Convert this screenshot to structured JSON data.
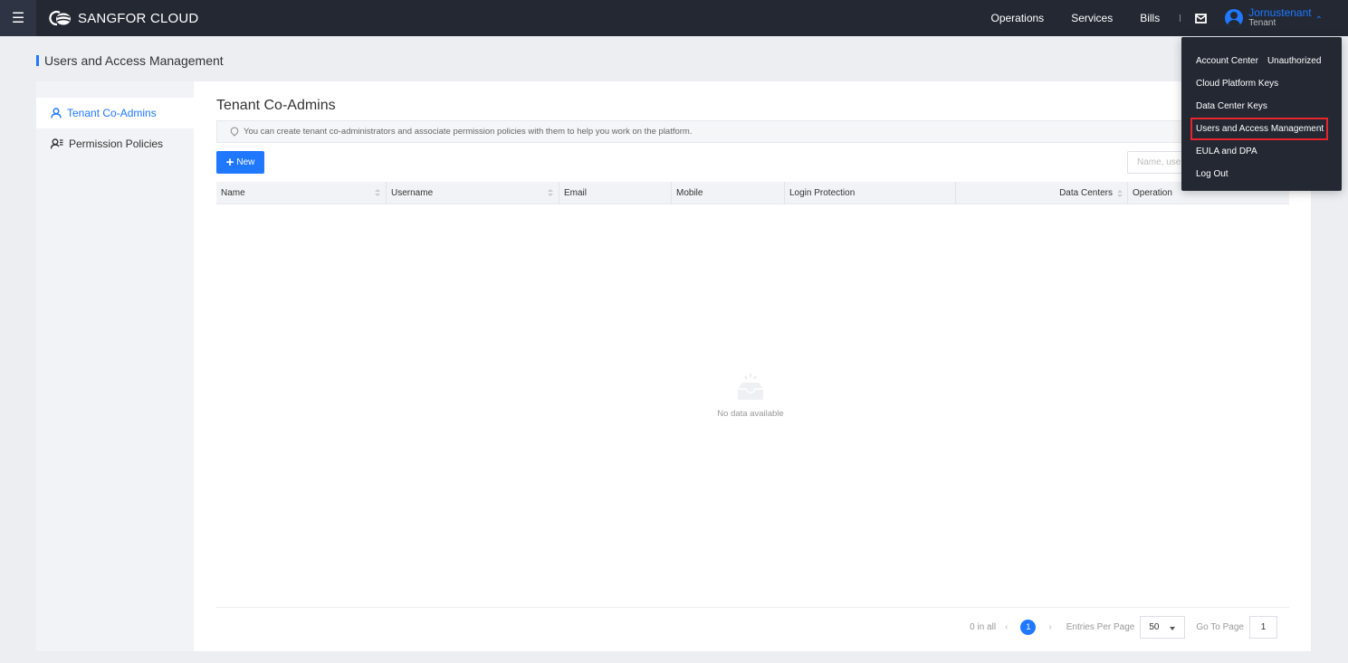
{
  "topbar": {
    "brand": "SANGFOR CLOUD",
    "nav": [
      "Operations",
      "Services",
      "Bills"
    ],
    "user": {
      "name": "Jornustenant",
      "role": "Tenant"
    }
  },
  "page": {
    "title": "Users and Access Management"
  },
  "leftnav": {
    "items": [
      {
        "label": "Tenant Co-Admins",
        "active": true
      },
      {
        "label": "Permission Policies",
        "active": false
      }
    ]
  },
  "main": {
    "title": "Tenant Co-Admins",
    "tip": "You can create tenant co-administrators and associate permission policies with them to help you work on the platform.",
    "new_label": "New",
    "search_placeholder": "Name, username",
    "columns": [
      "Name",
      "Username",
      "Email",
      "Mobile",
      "Login Protection",
      "Data Centers",
      "Operation"
    ],
    "empty_text": "No data available"
  },
  "pagination": {
    "total_label": "0 in all",
    "current_page": "1",
    "per_page_label": "Entries Per Page",
    "per_page_value": "50",
    "goto_label": "Go To Page",
    "goto_value": "1"
  },
  "dropdown": {
    "items": [
      {
        "label": "Account Center",
        "sub": "Unauthorized"
      },
      {
        "label": "Cloud Platform Keys"
      },
      {
        "label": "Data Center Keys"
      },
      {
        "label": "Users and Access Management",
        "highlight": true
      },
      {
        "label": "EULA and DPA"
      },
      {
        "label": "Log Out"
      }
    ]
  },
  "colors": {
    "accent": "#1f78ff",
    "topbar": "#232833",
    "highlight_border": "#e8252d"
  }
}
